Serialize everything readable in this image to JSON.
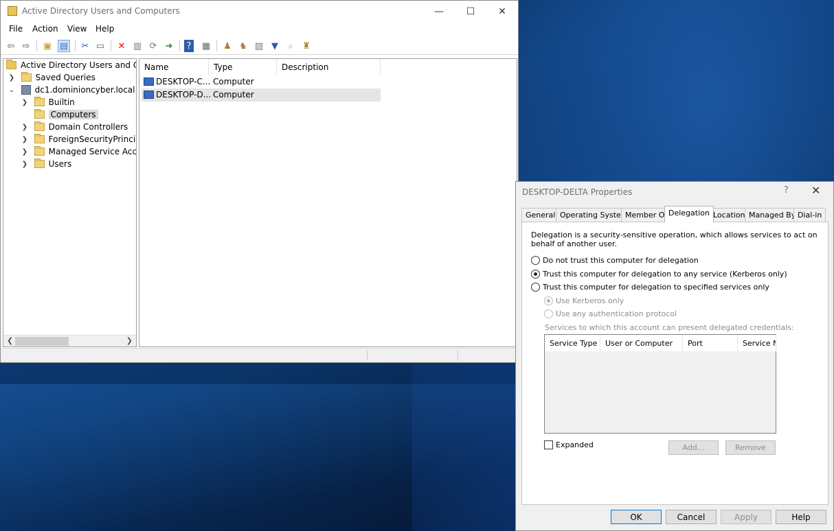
{
  "main_window": {
    "title": "Active Directory Users and Computers",
    "window_buttons": {
      "minimize": "—",
      "maximize": "☐",
      "close": "✕"
    },
    "menu": [
      "File",
      "Action",
      "View",
      "Help"
    ],
    "tree": {
      "root": "Active Directory Users and Com",
      "saved_queries": "Saved Queries",
      "domain": "dc1.dominioncyber.local",
      "children": [
        "Builtin",
        "Computers",
        "Domain Controllers",
        "ForeignSecurityPrincipals",
        "Managed Service Accour",
        "Users"
      ],
      "selected": "Computers"
    },
    "list": {
      "columns": [
        "Name",
        "Type",
        "Description"
      ],
      "rows": [
        {
          "name": "DESKTOP-C...",
          "type": "Computer",
          "description": ""
        },
        {
          "name": "DESKTOP-D...",
          "type": "Computer",
          "description": ""
        }
      ]
    }
  },
  "dialog": {
    "title": "DESKTOP-DELTA Properties",
    "help_glyph": "?",
    "close_glyph": "✕",
    "tabs": [
      "General",
      "Operating System",
      "Member Of",
      "Delegation",
      "Location",
      "Managed By",
      "Dial-in"
    ],
    "active_tab": "Delegation",
    "description_line1": "Delegation is a security-sensitive operation, which allows services to act on",
    "description_line2": "behalf of another user.",
    "options": [
      {
        "label": "Do not trust this computer for delegation",
        "selected": false
      },
      {
        "label": "Trust this computer for delegation to any service (Kerberos only)",
        "selected": true
      },
      {
        "label": "Trust this computer for delegation to specified services only",
        "selected": false
      }
    ],
    "sub_options": [
      {
        "label": "Use Kerberos only",
        "selected": true,
        "enabled": false
      },
      {
        "label": "Use any authentication protocol",
        "selected": false,
        "enabled": false
      }
    ],
    "services_label": "Services to which this account can present delegated credentials:",
    "services_columns": [
      "Service Type",
      "User or Computer",
      "Port",
      "Service Na"
    ],
    "expanded_label": "Expanded",
    "add_button": "Add...",
    "remove_button": "Remove",
    "buttons": {
      "ok": "OK",
      "cancel": "Cancel",
      "apply": "Apply",
      "help": "Help"
    }
  }
}
